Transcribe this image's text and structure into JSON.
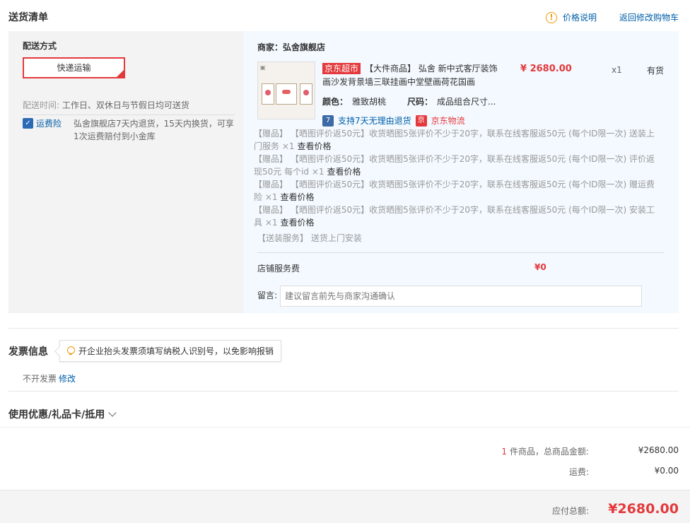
{
  "header": {
    "title": "送货清单",
    "price_note": "价格说明",
    "back_to_cart": "返回修改购物车"
  },
  "shipping": {
    "label": "配送方式",
    "method": "快递运输",
    "time_label": "配送时间:",
    "time_value": "工作日、双休日与节假日均可送货",
    "insurance_badge": "运费险",
    "insurance_text": "弘舍旗舰店7天内退货，15天内换货，可享1次运费赔付到小金库"
  },
  "order": {
    "merchant": "商家：弘舍旗舰店",
    "product": {
      "jd_tag": "京东超市",
      "name": "【大件商品】 弘舍 新中式客厅装饰画沙发背景墙三联挂画中堂壁画荷花国画",
      "price": "¥ 2680.00",
      "qty": "x1",
      "stock": "有货",
      "color_label": "颜色：",
      "color_value": "雅致胡桃",
      "size_label": "尺码：",
      "size_value": "成品组合尺寸...",
      "return_policy": "支持7天无理由退货",
      "return_icon": "7",
      "logistics_icon": "京",
      "logistics": "京东物流"
    },
    "gifts": [
      {
        "text": "【赠品】 【晒图评价返50元】收货晒图5张评价不少于20字，联系在线客服返50元 (每个ID限一次) 送装上门服务 ×1",
        "view": "查看价格"
      },
      {
        "text": "【赠品】 【晒图评价返50元】收货晒图5张评价不少于20字，联系在线客服返50元 (每个ID限一次) 评价返现50元 每个id ×1",
        "view": "查看价格"
      },
      {
        "text": "【赠品】 【晒图评价返50元】收货晒图5张评价不少于20字，联系在线客服返50元 (每个ID限一次) 赠运费险 ×1",
        "view": "查看价格"
      },
      {
        "text": "【赠品】 【晒图评价返50元】收货晒图5张评价不少于20字，联系在线客服返50元 (每个ID限一次) 安装工具 ×1",
        "view": "查看价格"
      }
    ],
    "install_service": "【送装服务】 送货上门安装",
    "store_fee_label": "店铺服务费",
    "store_fee_value": "¥0",
    "remark_label": "留言:",
    "remark_placeholder": "建议留言前先与商家沟通确认"
  },
  "invoice": {
    "title": "发票信息",
    "tip": "开企业抬头发票须填写纳税人识别号，以免影响报销",
    "value": "不开发票",
    "edit": "修改"
  },
  "coupons": {
    "label": "使用优惠/礼品卡/抵用"
  },
  "summary": {
    "count": "1",
    "count_label": "件商品，总商品金额:",
    "total": "¥2680.00",
    "freight_label": "运费:",
    "freight": "¥0.00",
    "payable_label": "应付总额:",
    "payable": "¥2680.00"
  },
  "colors": {
    "accent": "#e4393c",
    "link": "#005ea7",
    "warn": "#f39800"
  }
}
